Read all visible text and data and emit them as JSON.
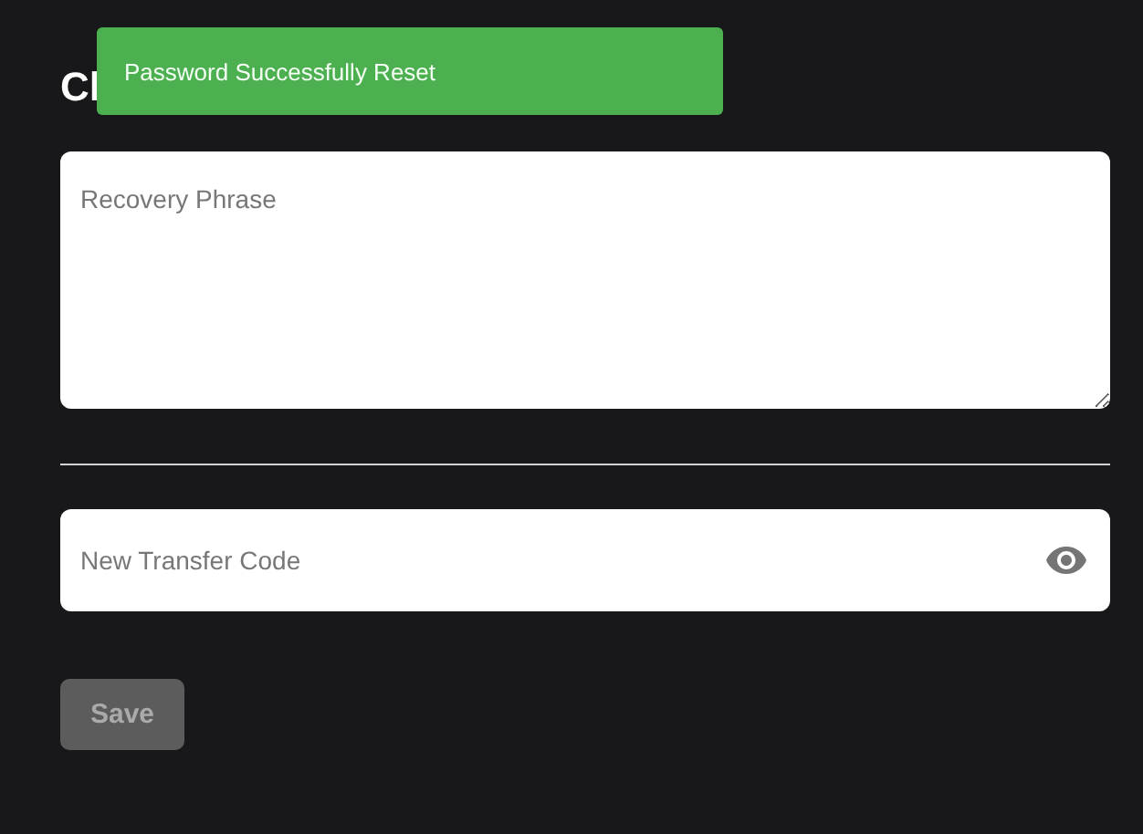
{
  "heading": "Cl",
  "toast": {
    "message": "Password Successfully Reset",
    "kind": "success"
  },
  "recovery_phrase": {
    "placeholder": "Recovery Phrase"
  },
  "transfer_code": {
    "placeholder": "New Transfer Code"
  },
  "save_button": {
    "label": "Save",
    "disabled": true
  }
}
